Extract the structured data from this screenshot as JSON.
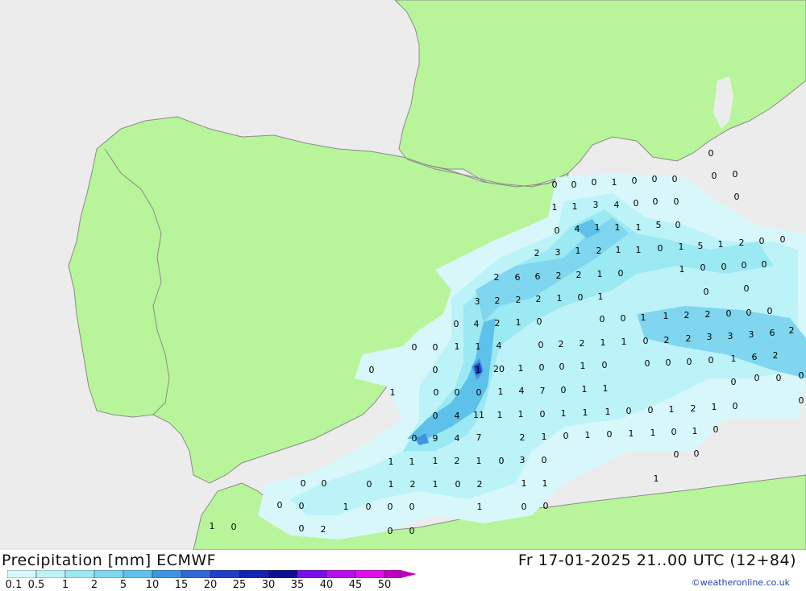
{
  "title": {
    "left": "Precipitation [mm] ECMWF",
    "right": "Fr 17-01-2025 21..00 UTC (12+84)"
  },
  "credit": "©weatheronline.co.uk",
  "legend": {
    "labels": [
      "0.1",
      "0.5",
      "1",
      "2",
      "5",
      "10",
      "15",
      "20",
      "25",
      "30",
      "35",
      "40",
      "45",
      "50"
    ],
    "colors": [
      "#d7f7fb",
      "#bcf3f8",
      "#9be9f2",
      "#7fd6ee",
      "#5ec1e9",
      "#3e95e0",
      "#2f6ad6",
      "#2040c8",
      "#1424b0",
      "#0f0f96",
      "#7a10e8",
      "#b410e8",
      "#e010e8",
      "#c000c0"
    ]
  },
  "map": {
    "land_color": "#b8f59a",
    "sea_color": "#ececec",
    "border_color": "#8a8a8a"
  },
  "values": [
    {
      "v": "0"
    },
    {
      "v": "0"
    },
    {
      "v": "0"
    },
    {
      "v": "1"
    },
    {
      "v": "0"
    },
    {
      "v": "0"
    },
    {
      "v": "0"
    },
    {
      "v": "0"
    },
    {
      "v": "0"
    },
    {
      "v": "0"
    },
    {
      "v": "0"
    },
    {
      "v": "1"
    },
    {
      "v": "1"
    },
    {
      "v": "3"
    },
    {
      "v": "4"
    },
    {
      "v": "0"
    },
    {
      "v": "0"
    },
    {
      "v": "0"
    },
    {
      "v": "0"
    },
    {
      "v": "4"
    },
    {
      "v": "1"
    },
    {
      "v": "1"
    },
    {
      "v": "1"
    },
    {
      "v": "5"
    },
    {
      "v": "0"
    },
    {
      "v": "2"
    },
    {
      "v": "3"
    },
    {
      "v": "1"
    },
    {
      "v": "2"
    },
    {
      "v": "1"
    },
    {
      "v": "1"
    },
    {
      "v": "0"
    },
    {
      "v": "1"
    },
    {
      "v": "5"
    },
    {
      "v": "1"
    },
    {
      "v": "2"
    },
    {
      "v": "0"
    },
    {
      "v": "0"
    },
    {
      "v": "2"
    },
    {
      "v": "6"
    },
    {
      "v": "6"
    },
    {
      "v": "2"
    },
    {
      "v": "2"
    },
    {
      "v": "1"
    },
    {
      "v": "0"
    },
    {
      "v": "1"
    },
    {
      "v": "0"
    },
    {
      "v": "0"
    },
    {
      "v": "0"
    },
    {
      "v": "0"
    },
    {
      "v": "3"
    },
    {
      "v": "2"
    },
    {
      "v": "2"
    },
    {
      "v": "2"
    },
    {
      "v": "1"
    },
    {
      "v": "0"
    },
    {
      "v": "1"
    },
    {
      "v": "0"
    },
    {
      "v": "0"
    },
    {
      "v": "0"
    },
    {
      "v": "4"
    },
    {
      "v": "2"
    },
    {
      "v": "1"
    },
    {
      "v": "0"
    },
    {
      "v": "0"
    },
    {
      "v": "0"
    },
    {
      "v": "1"
    },
    {
      "v": "1"
    },
    {
      "v": "2"
    },
    {
      "v": "2"
    },
    {
      "v": "0"
    },
    {
      "v": "0"
    },
    {
      "v": "0"
    },
    {
      "v": "0"
    },
    {
      "v": "0"
    },
    {
      "v": "1"
    },
    {
      "v": "1"
    },
    {
      "v": "4"
    },
    {
      "v": "0"
    },
    {
      "v": "2"
    },
    {
      "v": "2"
    },
    {
      "v": "1"
    },
    {
      "v": "1"
    },
    {
      "v": "0"
    },
    {
      "v": "2"
    },
    {
      "v": "2"
    },
    {
      "v": "3"
    },
    {
      "v": "3"
    },
    {
      "v": "3"
    },
    {
      "v": "6"
    },
    {
      "v": "2"
    },
    {
      "v": "0"
    },
    {
      "v": "0"
    },
    {
      "v": "1"
    },
    {
      "v": "20"
    },
    {
      "v": "1"
    },
    {
      "v": "0"
    },
    {
      "v": "0"
    },
    {
      "v": "1"
    },
    {
      "v": "0"
    },
    {
      "v": "0"
    },
    {
      "v": "0"
    },
    {
      "v": "0"
    },
    {
      "v": "0"
    },
    {
      "v": "1"
    },
    {
      "v": "6"
    },
    {
      "v": "2"
    },
    {
      "v": "1"
    },
    {
      "v": "0"
    },
    {
      "v": "0"
    },
    {
      "v": "0"
    },
    {
      "v": "1"
    },
    {
      "v": "4"
    },
    {
      "v": "7"
    },
    {
      "v": "0"
    },
    {
      "v": "1"
    },
    {
      "v": "1"
    },
    {
      "v": "0"
    },
    {
      "v": "0"
    },
    {
      "v": "0"
    },
    {
      "v": "0"
    },
    {
      "v": "0"
    },
    {
      "v": "4"
    },
    {
      "v": "11"
    },
    {
      "v": "1"
    },
    {
      "v": "1"
    },
    {
      "v": "0"
    },
    {
      "v": "1"
    },
    {
      "v": "1"
    },
    {
      "v": "1"
    },
    {
      "v": "0"
    },
    {
      "v": "0"
    },
    {
      "v": "1"
    },
    {
      "v": "2"
    },
    {
      "v": "1"
    },
    {
      "v": "0"
    },
    {
      "v": "0"
    },
    {
      "v": "0"
    },
    {
      "v": "9"
    },
    {
      "v": "4"
    },
    {
      "v": "7"
    },
    {
      "v": "2"
    },
    {
      "v": "1"
    },
    {
      "v": "0"
    },
    {
      "v": "1"
    },
    {
      "v": "0"
    },
    {
      "v": "1"
    },
    {
      "v": "1"
    },
    {
      "v": "0"
    },
    {
      "v": "1"
    },
    {
      "v": "0"
    },
    {
      "v": "1"
    },
    {
      "v": "1"
    },
    {
      "v": "1"
    },
    {
      "v": "2"
    },
    {
      "v": "1"
    },
    {
      "v": "0"
    },
    {
      "v": "3"
    },
    {
      "v": "0"
    },
    {
      "v": "0"
    },
    {
      "v": "0"
    },
    {
      "v": "0"
    },
    {
      "v": "0"
    },
    {
      "v": "0"
    },
    {
      "v": "1"
    },
    {
      "v": "2"
    },
    {
      "v": "1"
    },
    {
      "v": "0"
    },
    {
      "v": "2"
    },
    {
      "v": "1"
    },
    {
      "v": "1"
    },
    {
      "v": "1"
    },
    {
      "v": "0"
    },
    {
      "v": "0"
    },
    {
      "v": "1"
    },
    {
      "v": "0"
    },
    {
      "v": "0"
    },
    {
      "v": "0"
    },
    {
      "v": "1"
    },
    {
      "v": "0"
    },
    {
      "v": "0"
    },
    {
      "v": "1"
    },
    {
      "v": "0"
    },
    {
      "v": "0"
    },
    {
      "v": "2"
    },
    {
      "v": "0"
    },
    {
      "v": "0"
    },
    {
      "v": "0"
    }
  ]
}
